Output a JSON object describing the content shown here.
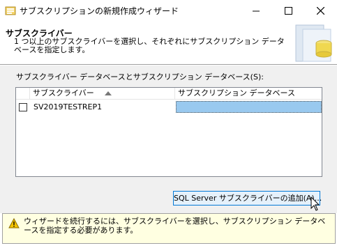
{
  "window": {
    "title": "サブスクリプションの新規作成ウィザード",
    "minimize_icon": "minimize-icon",
    "maximize_icon": "maximize-icon",
    "close_icon": "close-icon"
  },
  "header": {
    "title": "サブスクライバー",
    "description": "1 つ以上のサブスクライバーを選択し、それぞれにサブスクリプション データベースを指定します。"
  },
  "grid": {
    "label": "サブスクライバー データベースとサブスクリプション データベース(S):",
    "columns": {
      "subscriber": "サブスクライバー",
      "subscription_db": "サブスクリプション データベース"
    },
    "sort_icon": "sort-ascending-icon",
    "rows": [
      {
        "checked": false,
        "subscriber": "SV2019TESTREP1",
        "subscription_db": ""
      }
    ]
  },
  "actions": {
    "add_subscriber": "SQL Server サブスクライバーの追加(A)..."
  },
  "warning": {
    "icon": "warning-icon",
    "text": "ウィザードを続行するには、サブスクライバーを選択し、サブスクリプション データベースを指定する必要があります。"
  },
  "colors": {
    "selection": "#99c9ef",
    "button_focus": "#0078d7",
    "warning_bg": "#ffffe1"
  }
}
